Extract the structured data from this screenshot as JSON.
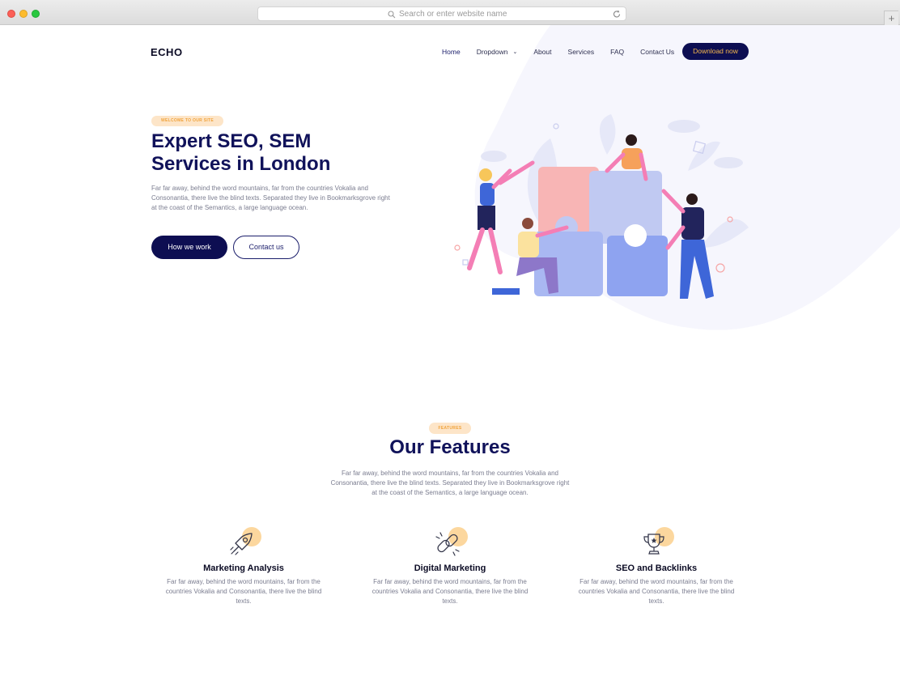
{
  "browser": {
    "url_placeholder": "Search or enter website name",
    "new_tab": "+"
  },
  "brand": {
    "logo": "ECHO"
  },
  "nav": {
    "items": [
      "Home",
      "Dropdown",
      "About",
      "Services",
      "FAQ",
      "Contact Us"
    ],
    "active": "Home",
    "cta": "Download now"
  },
  "hero": {
    "badge": "WELCOME TO OUR SITE",
    "title_line1": "Expert SEO, SEM",
    "title_line2": "Services in London",
    "text": "Far far away, behind the word mountains, far from the countries Vokalia and Consonantia, there live the blind texts. Separated they live in Bookmarksgrove right at the coast of the Semantics, a large language ocean.",
    "primary_button": "How we work",
    "secondary_button": "Contact us"
  },
  "features_section": {
    "badge": "FEATURES",
    "title": "Our Features",
    "text": "Far far away, behind the word mountains, far from the countries Vokalia and Consonantia, there live the blind texts. Separated they live in Bookmarksgrove right at the coast of the Semantics, a large language ocean.",
    "items": [
      {
        "icon": "rocket-icon",
        "title": "Marketing Analysis",
        "text": "Far far away, behind the word mountains, far from the countries Vokalia and Consonantia, there live the blind texts."
      },
      {
        "icon": "link-icon",
        "title": "Digital Marketing",
        "text": "Far far away, behind the word mountains, far from the countries Vokalia and Consonantia, there live the blind texts."
      },
      {
        "icon": "trophy-icon",
        "title": "SEO and Backlinks",
        "text": "Far far away, behind the word mountains, far from the countries Vokalia and Consonantia, there live the blind texts."
      }
    ]
  },
  "colors": {
    "primary": "#0d0e52",
    "accent": "#f6b84d",
    "badge_bg": "#fde5c8",
    "text_muted": "#7b7d90"
  }
}
